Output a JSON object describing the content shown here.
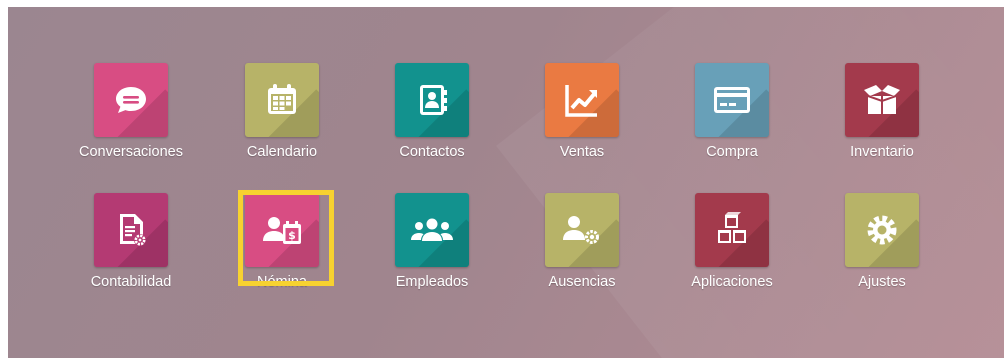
{
  "apps": [
    {
      "label": "Conversaciones",
      "icon": "chat-bubble-icon",
      "color": "#d84d83"
    },
    {
      "label": "Calendario",
      "icon": "calendar-icon",
      "color": "#b7b368"
    },
    {
      "label": "Contactos",
      "icon": "address-book-icon",
      "color": "#12928e"
    },
    {
      "label": "Ventas",
      "icon": "trend-chart-icon",
      "color": "#ea7a42"
    },
    {
      "label": "Compra",
      "icon": "credit-card-icon",
      "color": "#68a0b8"
    },
    {
      "label": "Inventario",
      "icon": "open-box-icon",
      "color": "#a33a4c"
    },
    {
      "label": "Contabilidad",
      "icon": "document-gear-icon",
      "color": "#b43a73"
    },
    {
      "label": "Nómina",
      "icon": "employee-payroll-icon",
      "color": "#d84d83"
    },
    {
      "label": "Empleados",
      "icon": "people-group-icon",
      "color": "#12928e"
    },
    {
      "label": "Ausencias",
      "icon": "person-gear-icon",
      "color": "#b7b368"
    },
    {
      "label": "Aplicaciones",
      "icon": "cubes-icon",
      "color": "#a33a4c"
    },
    {
      "label": "Ajustes",
      "icon": "gear-icon",
      "color": "#b7b368"
    }
  ],
  "highlight": {
    "target": "Nómina",
    "color": "#f7d230"
  }
}
